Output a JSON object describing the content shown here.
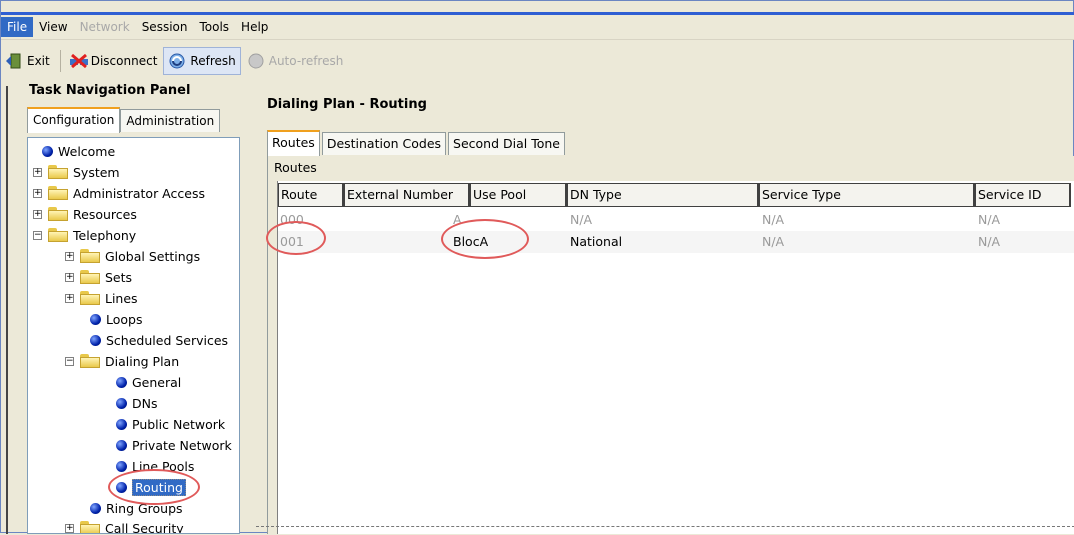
{
  "menu": [
    "File",
    "View",
    "Network",
    "Session",
    "Tools",
    "Help"
  ],
  "toolbar": {
    "exit": "Exit",
    "disconnect": "Disconnect",
    "refresh": "Refresh",
    "auto_refresh": "Auto-refresh"
  },
  "left_panel": {
    "title": "Task Navigation Panel",
    "tabs": [
      "Configuration",
      "Administration"
    ],
    "tree": [
      {
        "label": "Welcome"
      },
      {
        "label": "System"
      },
      {
        "label": "Administrator Access"
      },
      {
        "label": "Resources"
      },
      {
        "label": "Telephony"
      },
      {
        "label": "Global Settings"
      },
      {
        "label": "Sets"
      },
      {
        "label": "Lines"
      },
      {
        "label": "Loops"
      },
      {
        "label": "Scheduled Services"
      },
      {
        "label": "Dialing Plan"
      },
      {
        "label": "General"
      },
      {
        "label": "DNs"
      },
      {
        "label": "Public Network"
      },
      {
        "label": "Private Network"
      },
      {
        "label": "Line Pools"
      },
      {
        "label": "Routing"
      },
      {
        "label": "Ring Groups"
      },
      {
        "label": "Call Security"
      }
    ]
  },
  "right_panel": {
    "title": "Dialing Plan - Routing",
    "tabs": [
      "Routes",
      "Destination Codes",
      "Second Dial Tone"
    ],
    "section_label": "Routes",
    "columns": [
      "Route",
      "External Number",
      "Use Pool",
      "DN Type",
      "Service Type",
      "Service ID"
    ],
    "rows": [
      {
        "route": "000",
        "external": "",
        "pool": "A",
        "dn_type": "N/A",
        "service_type": "N/A",
        "service_id": "N/A"
      },
      {
        "route": "001",
        "external": "",
        "pool": "BlocA",
        "dn_type": "National",
        "service_type": "N/A",
        "service_id": "N/A"
      }
    ]
  },
  "colors": {
    "selection": "#316ac5",
    "annotation_circle": "#e05a5a",
    "tab_highlight": "#f0a01e"
  }
}
